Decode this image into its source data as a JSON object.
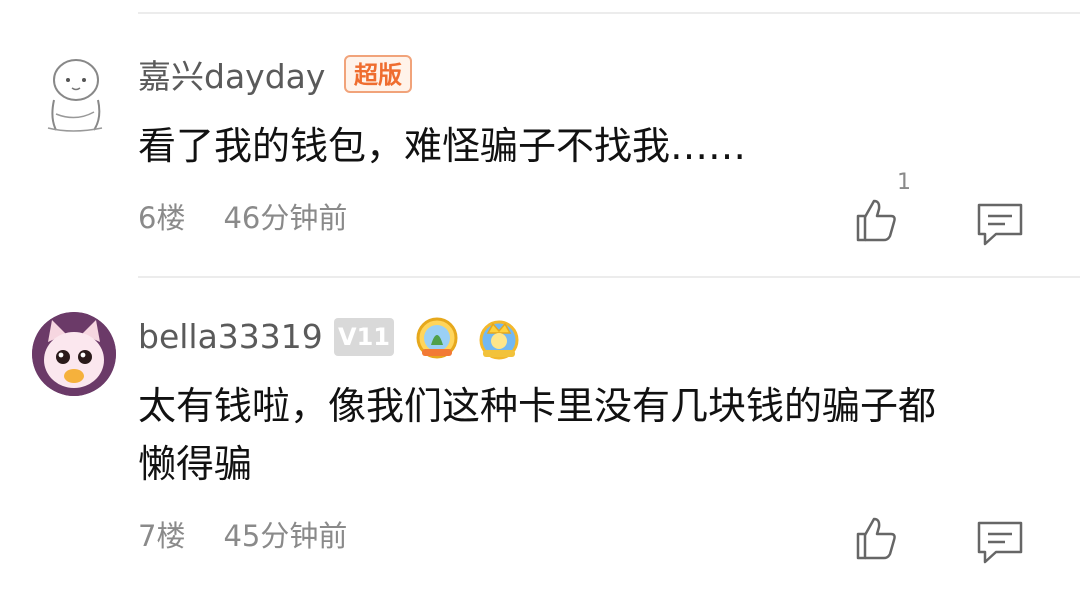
{
  "comments": [
    {
      "username": "嘉兴dayday",
      "badge": "超版",
      "content_lines": [
        "看了我的钱包，难怪骗子不找我……"
      ],
      "floor": "6楼",
      "time": "46分钟前",
      "likes": "1"
    },
    {
      "username": "bella33319",
      "badge": "V11",
      "content_lines": [
        "太有钱啦，像我们这种卡里没有几块钱的骗子都",
        "懒得骗"
      ],
      "floor": "7楼",
      "time": "45分钟前",
      "likes": ""
    }
  ],
  "icons": {
    "like": "thumbs-up-icon",
    "reply": "comment-bubble-icon",
    "medal1": "badge-medal-icon",
    "medal2": "crown-medal-icon"
  },
  "colors": {
    "badge_orange": "#ef6d2f",
    "level_gray": "#d9d9d9",
    "meta_gray": "#8a8a8a"
  }
}
